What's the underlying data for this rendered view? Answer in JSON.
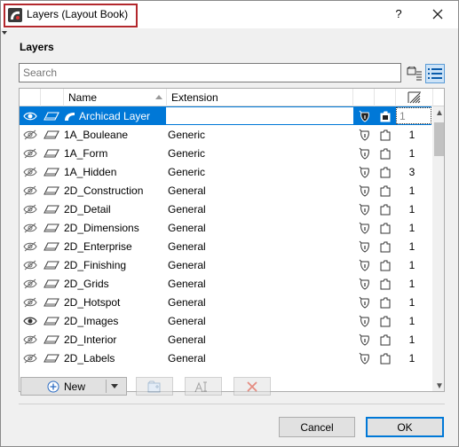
{
  "window": {
    "title": "Layers (Layout Book)",
    "help_label": "?"
  },
  "panel": {
    "section_label": "Layers",
    "search_placeholder": "Search"
  },
  "table": {
    "columns": {
      "name": "Name",
      "extension": "Extension"
    },
    "rows": [
      {
        "name": "Archicad Layer",
        "extension": "",
        "num": "1",
        "visible": true,
        "selected": true
      },
      {
        "name": "1A_Bouleane",
        "extension": "Generic",
        "num": "1",
        "visible": false
      },
      {
        "name": "1A_Form",
        "extension": "Generic",
        "num": "1",
        "visible": false
      },
      {
        "name": "1A_Hidden",
        "extension": "Generic",
        "num": "3",
        "visible": false
      },
      {
        "name": "2D_Construction",
        "extension": "General",
        "num": "1",
        "visible": false
      },
      {
        "name": "2D_Detail",
        "extension": "General",
        "num": "1",
        "visible": false
      },
      {
        "name": "2D_Dimensions",
        "extension": "General",
        "num": "1",
        "visible": false
      },
      {
        "name": "2D_Enterprise",
        "extension": "General",
        "num": "1",
        "visible": false
      },
      {
        "name": "2D_Finishing",
        "extension": "General",
        "num": "1",
        "visible": false
      },
      {
        "name": "2D_Grids",
        "extension": "General",
        "num": "1",
        "visible": false
      },
      {
        "name": "2D_Hotspot",
        "extension": "General",
        "num": "1",
        "visible": false
      },
      {
        "name": "2D_Images",
        "extension": "General",
        "num": "1",
        "visible": true
      },
      {
        "name": "2D_Interior",
        "extension": "General",
        "num": "1",
        "visible": false
      },
      {
        "name": "2D_Labels",
        "extension": "General",
        "num": "1",
        "visible": false
      }
    ]
  },
  "buttons": {
    "new_label": "New",
    "cancel_label": "Cancel",
    "ok_label": "OK"
  },
  "colors": {
    "selection": "#0078d7",
    "highlight_border": "#b3282d"
  }
}
